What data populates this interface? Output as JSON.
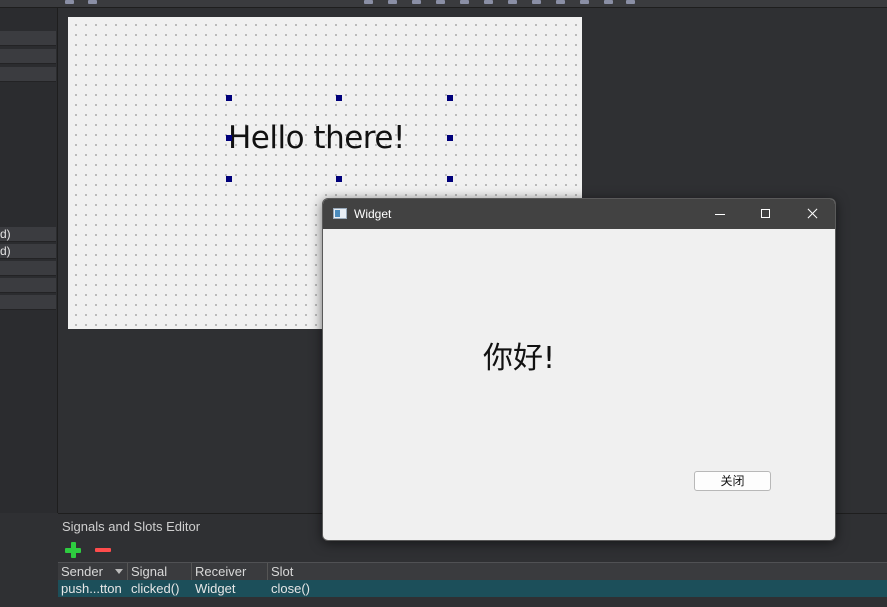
{
  "left_panel": {
    "rows": [
      "",
      "",
      "",
      "",
      "d)",
      "d)",
      "",
      "",
      ""
    ]
  },
  "designer_form": {
    "label_text": "Hello there!"
  },
  "signals_slots": {
    "title": "Signals and Slots Editor",
    "columns": [
      "Sender",
      "Signal",
      "Receiver",
      "Slot"
    ],
    "rows": [
      {
        "sender": "push...tton",
        "signal": "clicked()",
        "receiver": "Widget",
        "slot": "close()"
      }
    ]
  },
  "app_window": {
    "title": "Widget",
    "label_text": "你好!",
    "close_button": "关闭"
  },
  "colors": {
    "selected_row": "#1c4f5a",
    "handle": "#00007a",
    "add": "#2ecc40",
    "remove": "#ff4c4c"
  }
}
